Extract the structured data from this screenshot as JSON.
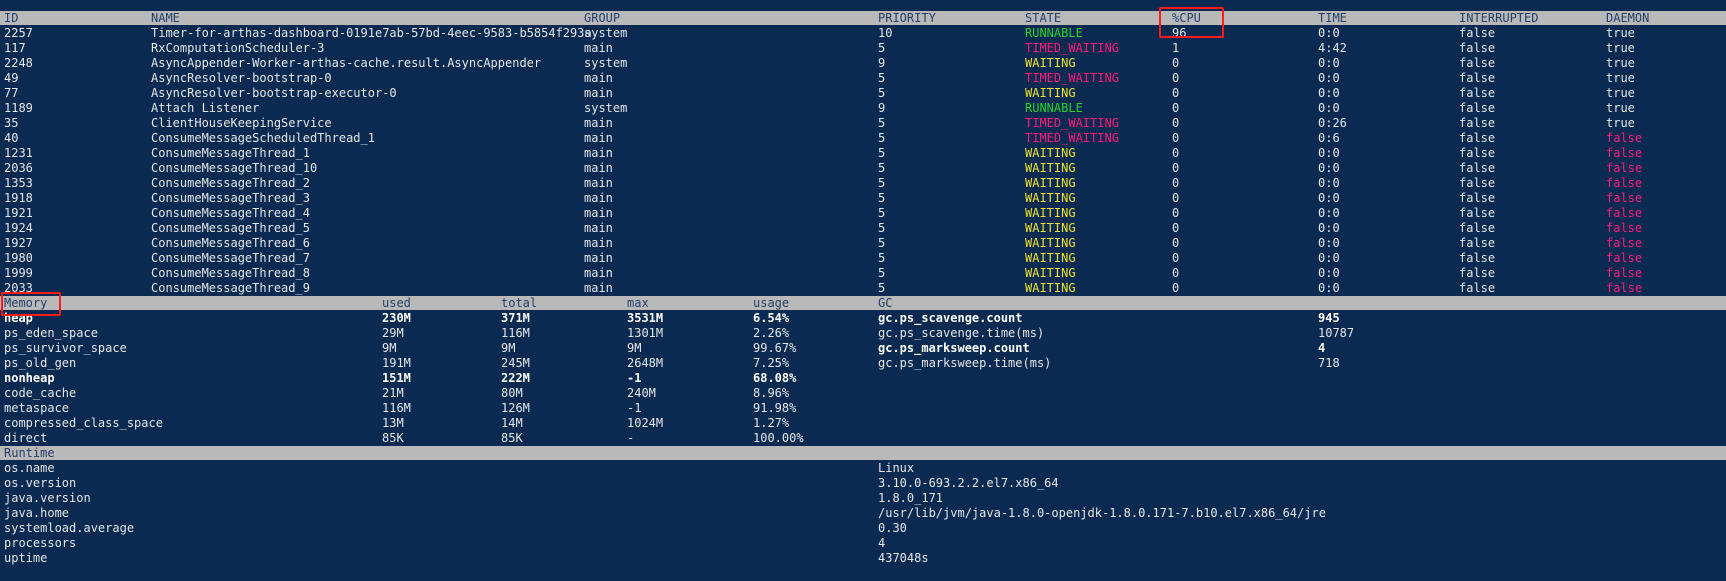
{
  "colors": {
    "background": "#0b2a52",
    "header_bg": "#b9b9b9",
    "runnable": "#24d12b",
    "timed_waiting": "#ff1a7a",
    "waiting": "#f1e12b",
    "highlight_box": "#ff1b1b"
  },
  "threads": {
    "headers": [
      "ID",
      "NAME",
      "GROUP",
      "PRIORITY",
      "STATE",
      "%CPU",
      "TIME",
      "INTERRUPTED",
      "DAEMON"
    ],
    "rows": [
      [
        "2257",
        "Timer-for-arthas-dashboard-0191e7ab-57bd-4eec-9583-b5854f293a",
        "system",
        "10",
        "RUNNABLE",
        "96",
        "0:0",
        "false",
        "true"
      ],
      [
        "117",
        "RxComputationScheduler-3",
        "main",
        "5",
        "TIMED_WAITING",
        "1",
        "4:42",
        "false",
        "true"
      ],
      [
        "2248",
        "AsyncAppender-Worker-arthas-cache.result.AsyncAppender",
        "system",
        "9",
        "WAITING",
        "0",
        "0:0",
        "false",
        "true"
      ],
      [
        "49",
        "AsyncResolver-bootstrap-0",
        "main",
        "5",
        "TIMED_WAITING",
        "0",
        "0:0",
        "false",
        "true"
      ],
      [
        "77",
        "AsyncResolver-bootstrap-executor-0",
        "main",
        "5",
        "WAITING",
        "0",
        "0:0",
        "false",
        "true"
      ],
      [
        "1189",
        "Attach Listener",
        "system",
        "9",
        "RUNNABLE",
        "0",
        "0:0",
        "false",
        "true"
      ],
      [
        "35",
        "ClientHouseKeepingService",
        "main",
        "5",
        "TIMED_WAITING",
        "0",
        "0:26",
        "false",
        "true"
      ],
      [
        "40",
        "ConsumeMessageScheduledThread_1",
        "main",
        "5",
        "TIMED_WAITING",
        "0",
        "0:6",
        "false",
        "false"
      ],
      [
        "1231",
        "ConsumeMessageThread_1",
        "main",
        "5",
        "WAITING",
        "0",
        "0:0",
        "false",
        "false"
      ],
      [
        "2036",
        "ConsumeMessageThread_10",
        "main",
        "5",
        "WAITING",
        "0",
        "0:0",
        "false",
        "false"
      ],
      [
        "1353",
        "ConsumeMessageThread_2",
        "main",
        "5",
        "WAITING",
        "0",
        "0:0",
        "false",
        "false"
      ],
      [
        "1918",
        "ConsumeMessageThread_3",
        "main",
        "5",
        "WAITING",
        "0",
        "0:0",
        "false",
        "false"
      ],
      [
        "1921",
        "ConsumeMessageThread_4",
        "main",
        "5",
        "WAITING",
        "0",
        "0:0",
        "false",
        "false"
      ],
      [
        "1924",
        "ConsumeMessageThread_5",
        "main",
        "5",
        "WAITING",
        "0",
        "0:0",
        "false",
        "false"
      ],
      [
        "1927",
        "ConsumeMessageThread_6",
        "main",
        "5",
        "WAITING",
        "0",
        "0:0",
        "false",
        "false"
      ],
      [
        "1980",
        "ConsumeMessageThread_7",
        "main",
        "5",
        "WAITING",
        "0",
        "0:0",
        "false",
        "false"
      ],
      [
        "1999",
        "ConsumeMessageThread_8",
        "main",
        "5",
        "WAITING",
        "0",
        "0:0",
        "false",
        "false"
      ],
      [
        "2033",
        "ConsumeMessageThread_9",
        "main",
        "5",
        "WAITING",
        "0",
        "0:0",
        "false",
        "false"
      ]
    ]
  },
  "memory": {
    "headers": [
      "Memory",
      "used",
      "total",
      "max",
      "usage",
      "GC"
    ],
    "rows": [
      {
        "name": "heap",
        "used": "230M",
        "total": "371M",
        "max": "3531M",
        "usage": "6.54%",
        "bold": true
      },
      {
        "name": "ps_eden_space",
        "used": "29M",
        "total": "116M",
        "max": "1301M",
        "usage": "2.26%",
        "bold": false
      },
      {
        "name": "ps_survivor_space",
        "used": "9M",
        "total": "9M",
        "max": "9M",
        "usage": "99.67%",
        "bold": false
      },
      {
        "name": "ps_old_gen",
        "used": "191M",
        "total": "245M",
        "max": "2648M",
        "usage": "7.25%",
        "bold": false
      },
      {
        "name": "nonheap",
        "used": "151M",
        "total": "222M",
        "max": "-1",
        "usage": "68.08%",
        "bold": true
      },
      {
        "name": "code_cache",
        "used": "21M",
        "total": "80M",
        "max": "240M",
        "usage": "8.96%",
        "bold": false
      },
      {
        "name": "metaspace",
        "used": "116M",
        "total": "126M",
        "max": "-1",
        "usage": "91.98%",
        "bold": false
      },
      {
        "name": "compressed_class_space",
        "used": "13M",
        "total": "14M",
        "max": "1024M",
        "usage": "1.27%",
        "bold": false
      },
      {
        "name": "direct",
        "used": "85K",
        "total": "85K",
        "max": "-",
        "usage": "100.00%",
        "bold": false
      }
    ],
    "gc": [
      {
        "name": "gc.ps_scavenge.count",
        "value": "945",
        "bold": true
      },
      {
        "name": "gc.ps_scavenge.time(ms)",
        "value": "10787",
        "bold": false
      },
      {
        "name": "gc.ps_marksweep.count",
        "value": "4",
        "bold": true
      },
      {
        "name": "gc.ps_marksweep.time(ms)",
        "value": "718",
        "bold": false
      }
    ]
  },
  "runtime": {
    "header": "Runtime",
    "rows": [
      {
        "name": "os.name",
        "value": "Linux"
      },
      {
        "name": "os.version",
        "value": "3.10.0-693.2.2.el7.x86_64"
      },
      {
        "name": "java.version",
        "value": "1.8.0_171"
      },
      {
        "name": "java.home",
        "value": "/usr/lib/jvm/java-1.8.0-openjdk-1.8.0.171-7.b10.el7.x86_64/jre"
      },
      {
        "name": "systemload.average",
        "value": "0.30"
      },
      {
        "name": "processors",
        "value": "4"
      },
      {
        "name": "uptime",
        "value": "437048s"
      }
    ]
  }
}
